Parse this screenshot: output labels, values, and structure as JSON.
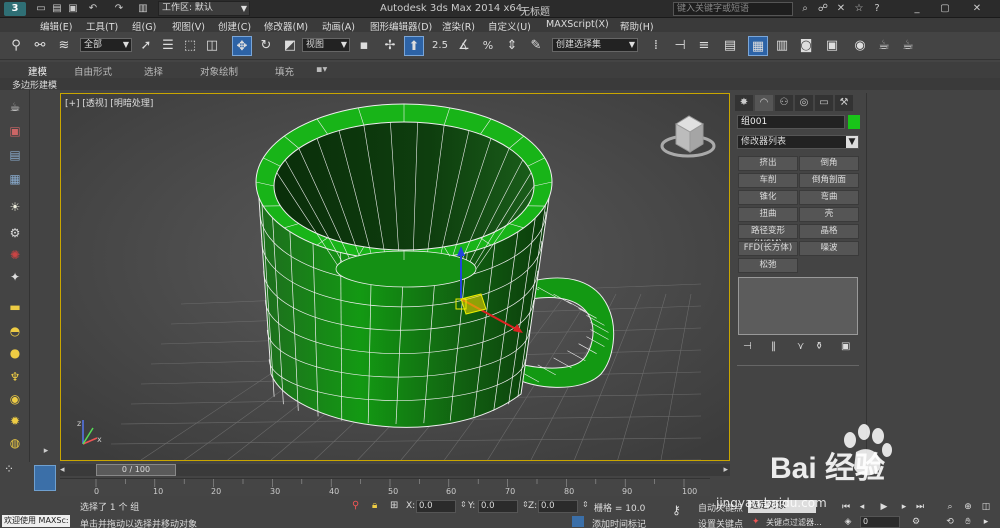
{
  "titlebar": {
    "logo": "3",
    "workspace": "工作区: 默认",
    "app_title": "Autodesk 3ds Max  2014 x64",
    "doc_title": "无标题",
    "search_placeholder": "键入关键字或短语"
  },
  "menu": [
    "编辑(E)",
    "工具(T)",
    "组(G)",
    "视图(V)",
    "创建(C)",
    "修改器(M)",
    "动画(A)",
    "图形编辑器(D)",
    "渲染(R)",
    "自定义(U)",
    "MAXScript(X)",
    "帮助(H)"
  ],
  "toolbar": {
    "selection_filter": "全部",
    "ref_coord": "视图",
    "named_selection": "创建选择集",
    "snap_label": "2.5",
    "percent_label": "%"
  },
  "ribbon": {
    "tabs": [
      "建模",
      "自由形式",
      "选择",
      "对象绘制",
      "填充"
    ],
    "active_tab": "建模",
    "sub_label": "多边形建模"
  },
  "viewport": {
    "label": "[+] [透视] [明暗处理]"
  },
  "command_panel": {
    "object_name": "组001",
    "object_color": "#19c419",
    "modifier_list": "修改器列表",
    "modifier_buttons": [
      [
        "挤出",
        "倒角"
      ],
      [
        "车削",
        "倒角剖面"
      ],
      [
        "锥化",
        "弯曲"
      ],
      [
        "扭曲",
        "壳"
      ],
      [
        "路径变形 (WSM)",
        "晶格"
      ],
      [
        "FFD(长方体)",
        "噪波"
      ],
      [
        "松弛",
        ""
      ]
    ]
  },
  "timeline": {
    "slider_label": "0 / 100",
    "ticks": [
      "0",
      "10",
      "20",
      "30",
      "40",
      "50",
      "60",
      "70",
      "80",
      "90",
      "100"
    ]
  },
  "status": {
    "maxscript_label": "欢迎使用  MAXSc:",
    "line1": "选择了 1 个 组",
    "line2": "单击并拖动以选择并移动对象",
    "x_label": "X:",
    "x_value": "0.0",
    "y_label": "Y:",
    "y_value": "0.0",
    "z_label": "Z:",
    "z_value": "0.0",
    "grid": "栅格 = 10.0",
    "add_time_tag": "添加时间标记",
    "auto_key": "自动关键点",
    "set_key": "设置关键点",
    "key_filter": "选定对象",
    "key_filter2": "关键点过滤器...",
    "frame": "0"
  },
  "watermark": {
    "brand": "Bai 经验",
    "url": "jingyan.baidu.com"
  }
}
